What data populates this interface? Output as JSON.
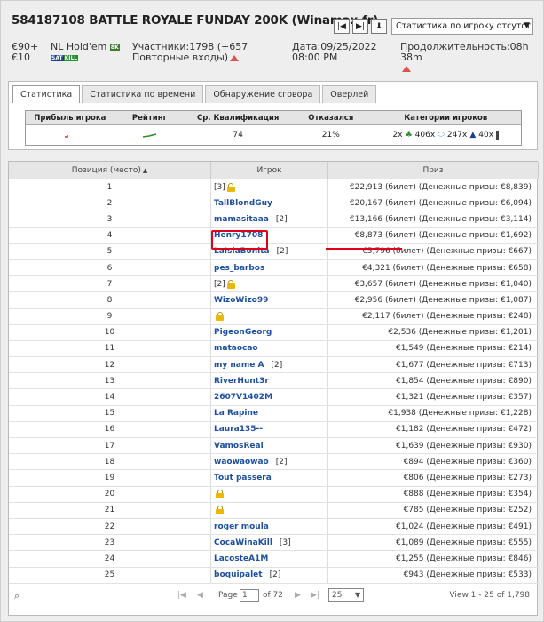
{
  "title": "584187108 BATTLE ROYALE FUNDAY 200K (Winamax.fr)",
  "nav": {
    "first": "|◀",
    "next": "▶|",
    "download": "⬇"
  },
  "stats_select": "Статистика по игроку отсутствует",
  "info": {
    "buyin": "€90+ €10",
    "game": "NL Hold'em",
    "badge_8k": "8K",
    "badge_sat": "SAT",
    "badge_kill": "KILL",
    "participants": "Участники:1798 (+657 Повторные входы)",
    "date": "Дата:09/25/2022 08:00 PM",
    "duration": "Продолжительность:08h 38m"
  },
  "tabs": [
    "Статистика",
    "Статистика по времени",
    "Обнаружение сговора",
    "Оверлей"
  ],
  "stats": {
    "headers": [
      "Прибыль игрока",
      "Рейтинг",
      "Ср. Квалификация",
      "Отказался",
      "Категории игроков"
    ],
    "qual": "74",
    "refused": "21%",
    "cat1": "2x",
    "cat2": "406x",
    "cat3": "247x",
    "cat4": "40x"
  },
  "grid": {
    "headers": [
      "Позиция (место)",
      "Игрок",
      "Приз"
    ],
    "sort_icon": "sort-icon",
    "rows": [
      {
        "pos": "1",
        "player": "",
        "bracket": "[3]",
        "lock": true,
        "prize": "€22,913 (билет) (Денежные призы: €8,839)"
      },
      {
        "pos": "2",
        "player": "TallBlondGuy",
        "bracket": "",
        "lock": false,
        "prize": "€20,167 (билет) (Денежные призы: €6,094)"
      },
      {
        "pos": "3",
        "player": "mamasitaaa",
        "bracket": "[2]",
        "lock": false,
        "prize": "€13,166 (билет) (Денежные призы: €3,114)"
      },
      {
        "pos": "4",
        "player": "Henry1708",
        "bracket": "",
        "lock": false,
        "prize": "€8,873 (билет) (Денежные призы: €1,692)"
      },
      {
        "pos": "5",
        "player": "LaIslaBonita",
        "bracket": "[2]",
        "lock": false,
        "prize": "€5,796 (билет) (Денежные призы: €667)"
      },
      {
        "pos": "6",
        "player": "pes_barbos",
        "bracket": "",
        "lock": false,
        "prize": "€4,321 (билет) (Денежные призы: €658)"
      },
      {
        "pos": "7",
        "player": "",
        "bracket": "[2]",
        "lock": true,
        "prize": "€3,657 (билет) (Денежные призы: €1,040)"
      },
      {
        "pos": "8",
        "player": "WizoWizo99",
        "bracket": "",
        "lock": false,
        "prize": "€2,956 (билет) (Денежные призы: €1,087)"
      },
      {
        "pos": "9",
        "player": "",
        "bracket": "",
        "lock": true,
        "prize": "€2,117 (билет) (Денежные призы: €248)"
      },
      {
        "pos": "10",
        "player": "PigeonGeorg",
        "bracket": "",
        "lock": false,
        "prize": "€2,536 (Денежные призы: €1,201)"
      },
      {
        "pos": "11",
        "player": "mataocao",
        "bracket": "",
        "lock": false,
        "prize": "€1,549 (Денежные призы: €214)"
      },
      {
        "pos": "12",
        "player": "my name A",
        "bracket": "[2]",
        "lock": false,
        "prize": "€1,677 (Денежные призы: €713)"
      },
      {
        "pos": "13",
        "player": "RiverHunt3r",
        "bracket": "",
        "lock": false,
        "prize": "€1,854 (Денежные призы: €890)"
      },
      {
        "pos": "14",
        "player": "2607V1402M",
        "bracket": "",
        "lock": false,
        "prize": "€1,321 (Денежные призы: €357)"
      },
      {
        "pos": "15",
        "player": "La Rapine",
        "bracket": "",
        "lock": false,
        "prize": "€1,938 (Денежные призы: €1,228)"
      },
      {
        "pos": "16",
        "player": "Laura135--",
        "bracket": "",
        "lock": false,
        "prize": "€1,182 (Денежные призы: €472)"
      },
      {
        "pos": "17",
        "player": "VamosReal",
        "bracket": "",
        "lock": false,
        "prize": "€1,639 (Денежные призы: €930)"
      },
      {
        "pos": "18",
        "player": "waowaowao",
        "bracket": "[2]",
        "lock": false,
        "prize": "€894 (Денежные призы: €360)"
      },
      {
        "pos": "19",
        "player": "Tout passera",
        "bracket": "",
        "lock": false,
        "prize": "€806 (Денежные призы: €273)"
      },
      {
        "pos": "20",
        "player": "",
        "bracket": "",
        "lock": true,
        "prize": "€888 (Денежные призы: €354)"
      },
      {
        "pos": "21",
        "player": "",
        "bracket": "",
        "lock": true,
        "prize": "€785 (Денежные призы: €252)"
      },
      {
        "pos": "22",
        "player": "roger moula",
        "bracket": "",
        "lock": false,
        "prize": "€1,024 (Денежные призы: €491)"
      },
      {
        "pos": "23",
        "player": "CocaWinaKill",
        "bracket": "[3]",
        "lock": false,
        "prize": "€1,089 (Денежные призы: €555)"
      },
      {
        "pos": "24",
        "player": "LacosteA1M",
        "bracket": "",
        "lock": false,
        "prize": "€1,255 (Денежные призы: €846)"
      },
      {
        "pos": "25",
        "player": "boquipalet",
        "bracket": "[2]",
        "lock": false,
        "prize": "€943 (Денежные призы: €533)"
      }
    ]
  },
  "pager": {
    "page_label": "Page",
    "page_value": "1",
    "of_label": "of 72",
    "per_page": "25",
    "view": "View 1 - 25 of 1,798"
  }
}
